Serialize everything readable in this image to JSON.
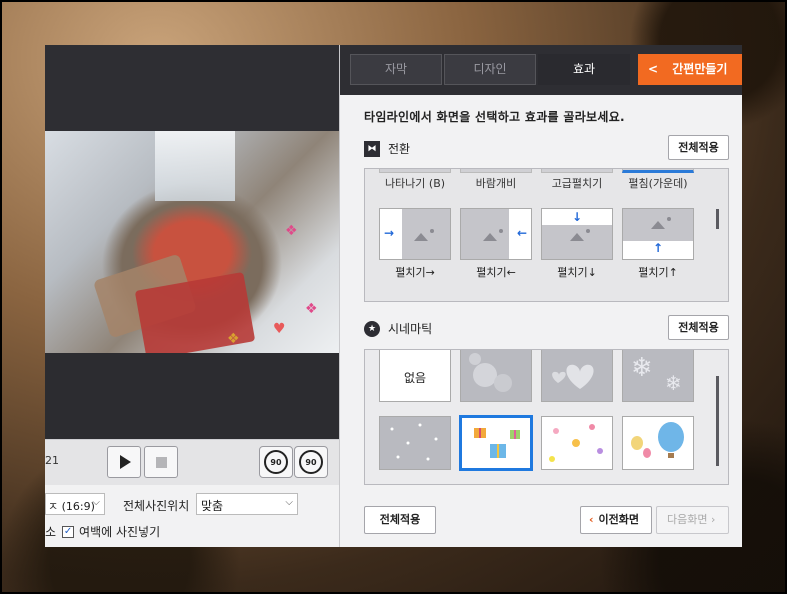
{
  "left_panel": {
    "time_text": "21",
    "ratio_select_value": "ㅈ (16:9)",
    "photo_position_label": "전체사진위치",
    "photo_position_value": "맞춤",
    "crop_label_partial": "소",
    "fill_margin_label": "여백에 사진넣기",
    "fill_margin_checked": true,
    "rotate_left_label": "90",
    "rotate_right_label": "90"
  },
  "tabs": [
    {
      "label": "자막",
      "active": false
    },
    {
      "label": "디자인",
      "active": false
    },
    {
      "label": "효과",
      "active": true
    }
  ],
  "quick_create_label": "간편만들기",
  "instruction": "타임라인에서 화면을 선택하고 효과를 골라보세요.",
  "transition": {
    "title": "전환",
    "apply_all": "전체적용",
    "top_labels": [
      "나타나기 (B)",
      "바람개비",
      "고급펼치기",
      "펼침(가운데)"
    ],
    "items": [
      {
        "label": "펼치기→",
        "arrow": "→"
      },
      {
        "label": "펼치기←",
        "arrow": "←"
      },
      {
        "label": "펼치기↓",
        "arrow": "↓"
      },
      {
        "label": "펼치기↑",
        "arrow": "↑"
      }
    ]
  },
  "cinematic": {
    "title": "시네마틱",
    "apply_all": "전체적용",
    "none_label": "없음"
  },
  "footer": {
    "apply_all": "전체적용",
    "prev": "이전화면",
    "next": "다음화면"
  },
  "colors": {
    "accent_orange": "#f26a21",
    "selection_blue": "#1f79df",
    "dark_panel": "#2e2e33"
  }
}
